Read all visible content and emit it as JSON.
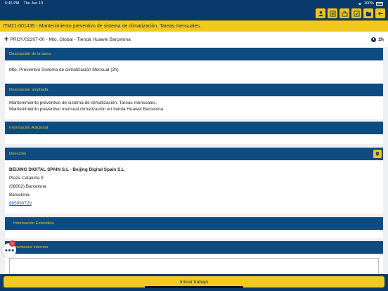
{
  "status_bar": {
    "time": "6:46 PM",
    "date": "Thu Jun 10",
    "battery": "100%"
  },
  "toolbar": {
    "icons": [
      "person-icon",
      "list-icon",
      "tools-icon",
      "checklist-icon",
      "folder-icon",
      "back-arrow-icon"
    ]
  },
  "task_title": "ITM21-001435 - Mantenimiento preventivo de sistema de climatización. Tareas mensuales.",
  "project": {
    "label": "PROY/02207-00 - Mto. Global - Tienda Huawei Barcelona",
    "duration": "2h"
  },
  "sections": {
    "descripcion_tarea": {
      "header": "Descripción de la tarea",
      "text": "Mto. Preventivo Sistema de climatización Mensual (2h)"
    },
    "descripcion_ampliada": {
      "header": "Descripción ampliada",
      "line1": "Mantenimiento preventivo de sistema de climatización. Tareas mensuales.",
      "line2": "Mantenimiento preventivo mensual climatización en tienda Huawei Barcelona"
    },
    "informacion_adicional": {
      "header": "Información Adicional"
    },
    "direccion": {
      "header": "Dirección",
      "company": "BEIJING DIGITAL SPAIN S.L - Beijing Digital Spain S.L",
      "street": "Plaza Cataluña 9",
      "postal": "(08002) Barcelona",
      "city": "Barcelona",
      "phone": "685990729"
    },
    "informacion_extendida": {
      "header": "Información Extendida"
    },
    "comentarios": {
      "header": "Comentarios Internos"
    }
  },
  "fab": {
    "badge_count": "0"
  },
  "footer": {
    "start_button": "Iniciar trabajo"
  }
}
